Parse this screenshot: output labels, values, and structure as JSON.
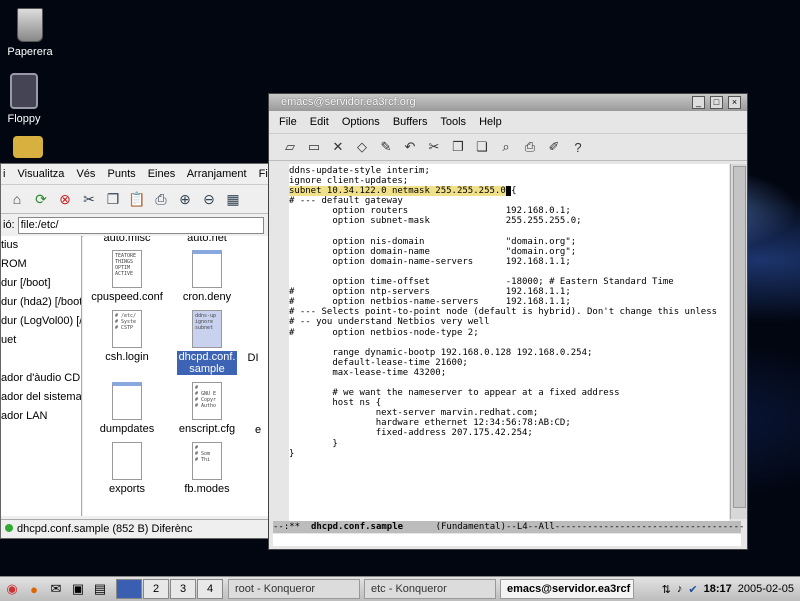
{
  "desktop": {
    "icons": [
      {
        "label": "Paperera",
        "icon": "trash-icon"
      },
      {
        "label": "Floppy",
        "icon": "floppy-icon"
      }
    ]
  },
  "konqueror": {
    "menus": [
      "Visualitza",
      "Vés",
      "Punts",
      "Eines",
      "Arranjament",
      "Finestra"
    ],
    "menu_first_fragment": "i",
    "location_label": "ió:",
    "location_value": "file:/etc/",
    "sidebar": [
      "tius",
      "ROM",
      "dur  [/boot]",
      "dur (hda2) [/boot",
      "dur (LogVol00) [/",
      "uet",
      "",
      "ador d'àudio CD",
      "ador del sistema d",
      "ador LAN"
    ],
    "files": [
      {
        "name": "auto.misc",
        "thumb": ""
      },
      {
        "name": "auto.net",
        "thumb": ""
      },
      {
        "name": "cpuspeed.conf",
        "thumb": "TEATORE\nTHINGS\nOPTIM\nACTIVE"
      },
      {
        "name": "cron.deny",
        "thumb": ""
      },
      {
        "name": "csh.login",
        "thumb": "# /etc/\n# Syste\n# CSTP"
      },
      {
        "name": "dhcpd.conf.\nsample",
        "thumb": "ddns-up\nignore\nsubnet",
        "selected": true
      },
      {
        "name": "dumpdates",
        "thumb": ""
      },
      {
        "name": "enscript.cfg",
        "thumb": "#\n# GNU E\n# Copyr\n# Autho"
      },
      {
        "name": "exports",
        "thumb": ""
      },
      {
        "name": "fb.modes",
        "thumb": "#\n# Som\n# Thi"
      },
      {
        "name": "DI",
        "thumb": ""
      },
      {
        "name": "e",
        "thumb": ""
      }
    ],
    "status": "dhcpd.conf.sample (852 B)  Diferènc"
  },
  "emacs": {
    "title": "emacs@servidor.ea3rcf.org",
    "menus": [
      "File",
      "Edit",
      "Options",
      "Buffers",
      "Tools",
      "Help"
    ],
    "toolbar_icons": [
      "open-file-icon",
      "open-dir-icon",
      "kill-buffer-icon",
      "save-icon",
      "save-as-icon",
      "undo-icon",
      "cut-icon",
      "copy-icon",
      "paste-icon",
      "search-icon",
      "print-icon",
      "customize-icon",
      "help-icon"
    ],
    "lines_before_hl": "ddns-update-style interim;\nignore client-updates;\n",
    "hl_line": "subnet 10.34.122.0 netmask 255.255.255.0",
    "cursor_char": " ",
    "after_cursor": "{",
    "lines_after": "\n# --- default gateway\n        option routers                  192.168.0.1;\n        option subnet-mask              255.255.255.0;\n\n        option nis-domain               \"domain.org\";\n        option domain-name              \"domain.org\";\n        option domain-name-servers      192.168.1.1;\n\n        option time-offset              -18000; # Eastern Standard Time\n#       option ntp-servers              192.168.1.1;\n#       option netbios-name-servers     192.168.1.1;\n# --- Selects point-to-point node (default is hybrid). Don't change this unless\n# -- you understand Netbios very well\n#       option netbios-node-type 2;\n\n        range dynamic-bootp 192.168.0.128 192.168.0.254;\n        default-lease-time 21600;\n        max-lease-time 43200;\n\n        # we want the nameserver to appear at a fixed address\n        host ns {\n                next-server marvin.redhat.com;\n                hardware ethernet 12:34:56:78:AB:CD;\n                fixed-address 207.175.42.254;\n        }\n}",
    "modeline_prefix": "--:**  ",
    "modeline_buffer": "dhcpd.conf.sample",
    "modeline_rest": "      (Fundamental)--L4--All-----------------------------------"
  },
  "taskbar": {
    "pager": [
      "",
      "2",
      "3",
      "4"
    ],
    "tasks": [
      {
        "label": "root - Konqueror",
        "active": false
      },
      {
        "label": "etc - Konqueror",
        "active": false
      },
      {
        "label": "emacs@servidor.ea3rcf",
        "active": true
      }
    ],
    "clock": "18:17",
    "date": "2005-02-05"
  }
}
